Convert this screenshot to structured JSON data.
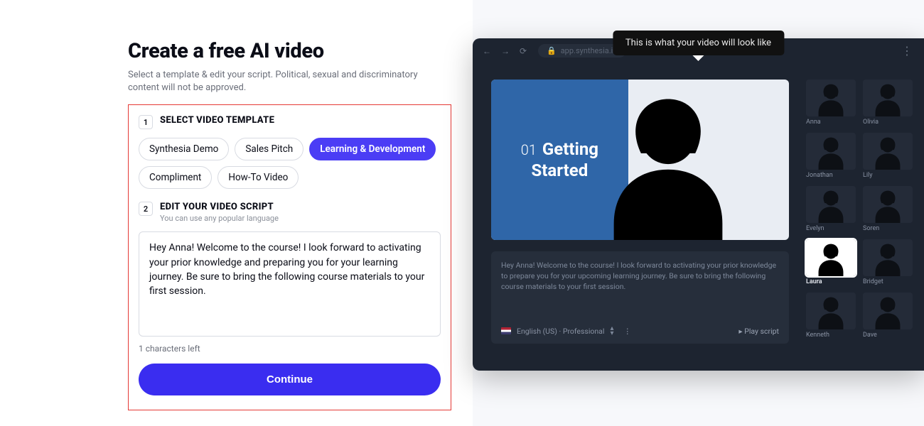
{
  "left": {
    "title": "Create a free AI video",
    "subtitle": "Select a template & edit your script. Political, sexual and discriminatory content will not be approved.",
    "step1": {
      "num": "1",
      "label": "SELECT VIDEO TEMPLATE"
    },
    "templates": [
      {
        "label": "Synthesia Demo",
        "selected": false
      },
      {
        "label": "Sales Pitch",
        "selected": false
      },
      {
        "label": "Learning & Development",
        "selected": true
      },
      {
        "label": "Compliment",
        "selected": false
      },
      {
        "label": "How-To Video",
        "selected": false
      }
    ],
    "step2": {
      "num": "2",
      "label": "EDIT YOUR VIDEO SCRIPT",
      "hint": "You can use any popular language"
    },
    "script_value": "Hey Anna! Welcome to the course! I look forward to activating your prior knowledge and preparing you for your learning journey. Be sure to bring the following course materials to your first session.",
    "chars_left": "1 characters left",
    "continue": "Continue"
  },
  "preview": {
    "tooltip": "This is what your video will look like",
    "address": "app.synthesia.io",
    "slide_prefix": "01",
    "slide_line1": "Getting",
    "slide_line2": "Started",
    "script_text": "Hey Anna! Welcome to the course! I look forward to activating your prior knowledge to prepare you for your upcoming learning journey. Be sure to bring the following course materials to your first session.",
    "language": "English (US) · Professional",
    "play_label": "▸  Play script",
    "avatars": [
      {
        "name": "Anna",
        "selected": false
      },
      {
        "name": "Olivia",
        "selected": false
      },
      {
        "name": "Jonathan",
        "selected": false
      },
      {
        "name": "Lily",
        "selected": false
      },
      {
        "name": "Evelyn",
        "selected": false
      },
      {
        "name": "Soren",
        "selected": false
      },
      {
        "name": "Laura",
        "selected": true
      },
      {
        "name": "Bridget",
        "selected": false
      },
      {
        "name": "Kenneth",
        "selected": false
      },
      {
        "name": "Dave",
        "selected": false
      }
    ]
  }
}
